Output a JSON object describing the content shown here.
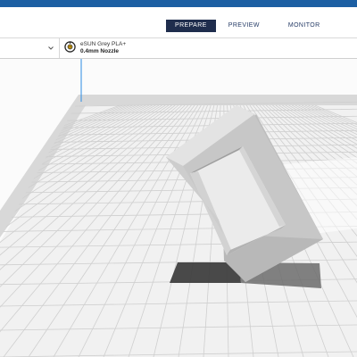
{
  "app": {
    "accent_color": "#1c5fa3"
  },
  "stages": [
    {
      "label": "PREPARE",
      "active": true
    },
    {
      "label": "PREVIEW",
      "active": false
    },
    {
      "label": "MONITOR",
      "active": false
    }
  ],
  "material": {
    "name": "eSUN Grey PLA+",
    "nozzle": "0.4mm Nozzle",
    "icon": "spool-icon"
  },
  "viewport": {
    "build_plate": "grid",
    "object": "hollow-rectangular-frame"
  }
}
